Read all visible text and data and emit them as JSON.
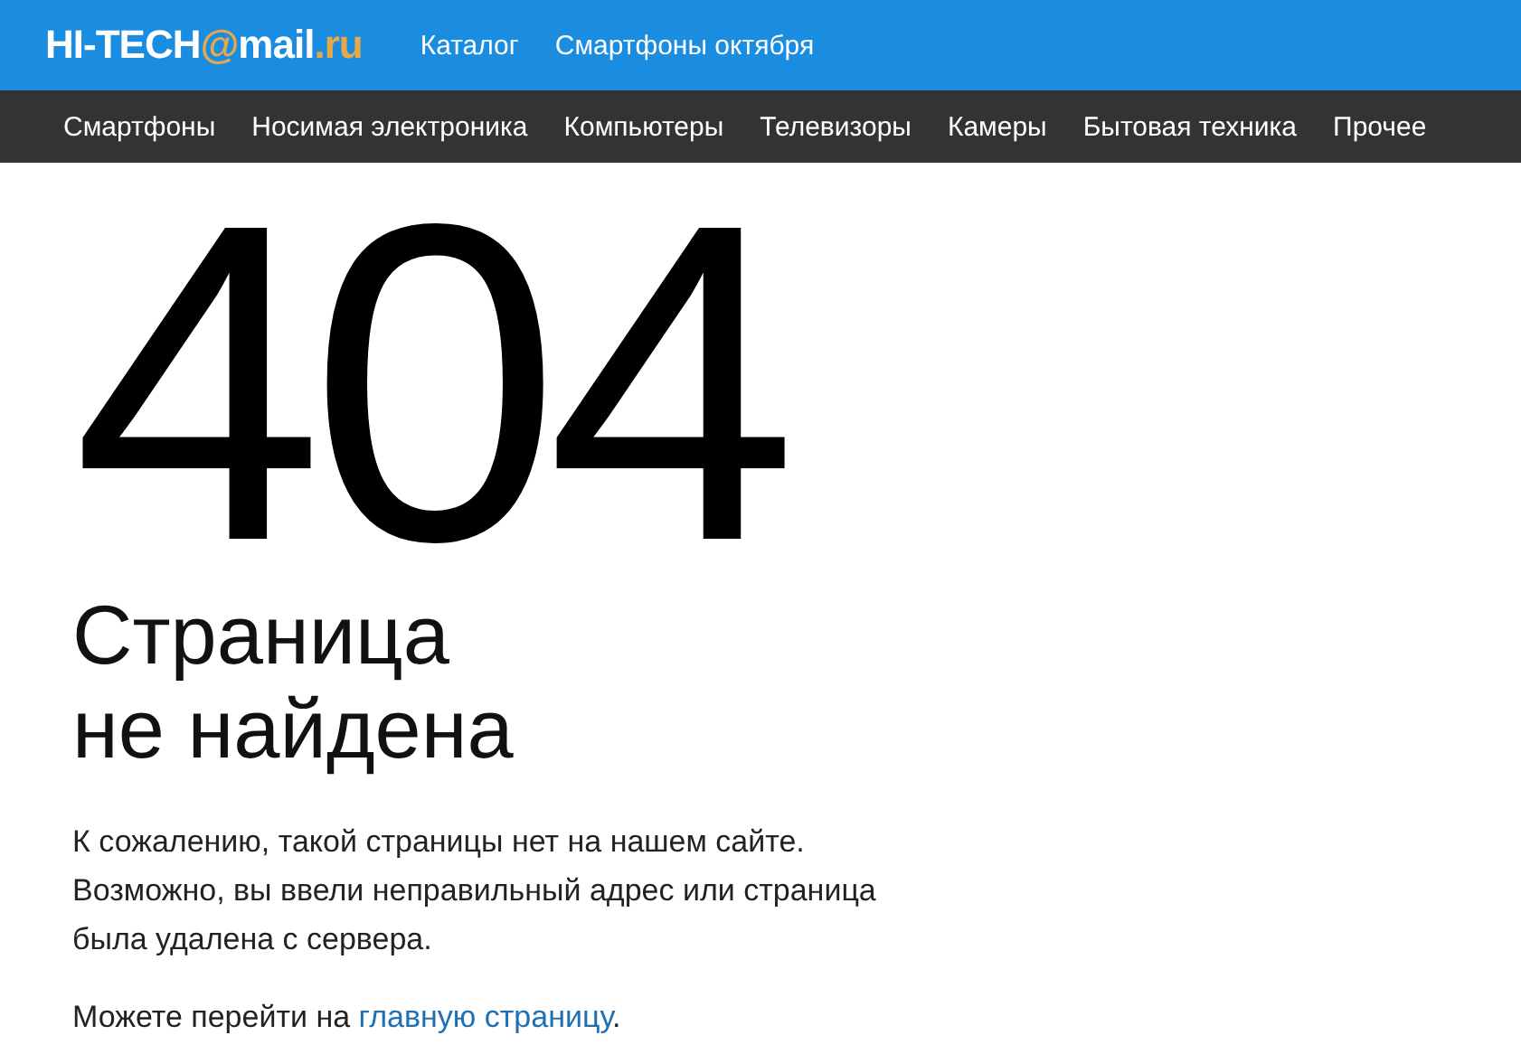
{
  "header": {
    "logo": [
      {
        "text": "HI-TECH",
        "color": "#ffffff"
      },
      {
        "text": "@",
        "color": "#e8a84a"
      },
      {
        "text": "mail",
        "color": "#ffffff"
      },
      {
        "text": ".ru",
        "color": "#e8a84a"
      }
    ],
    "links": [
      "Каталог",
      "Смартфоны октября"
    ]
  },
  "categories": [
    "Смартфоны",
    "Носимая электроника",
    "Компьютеры",
    "Телевизоры",
    "Камеры",
    "Бытовая техника",
    "Прочее"
  ],
  "error": {
    "code": "404",
    "title_lines": [
      "Страница",
      "не найдена"
    ],
    "message_lines": [
      "К сожалению, такой страницы нет на нашем сайте.",
      "Возможно, вы ввели неправильный адрес или страница",
      "была удалена с сервера."
    ],
    "suggestion": {
      "before": "Можете перейти на ",
      "link": "главную страницу",
      "after": "."
    }
  }
}
